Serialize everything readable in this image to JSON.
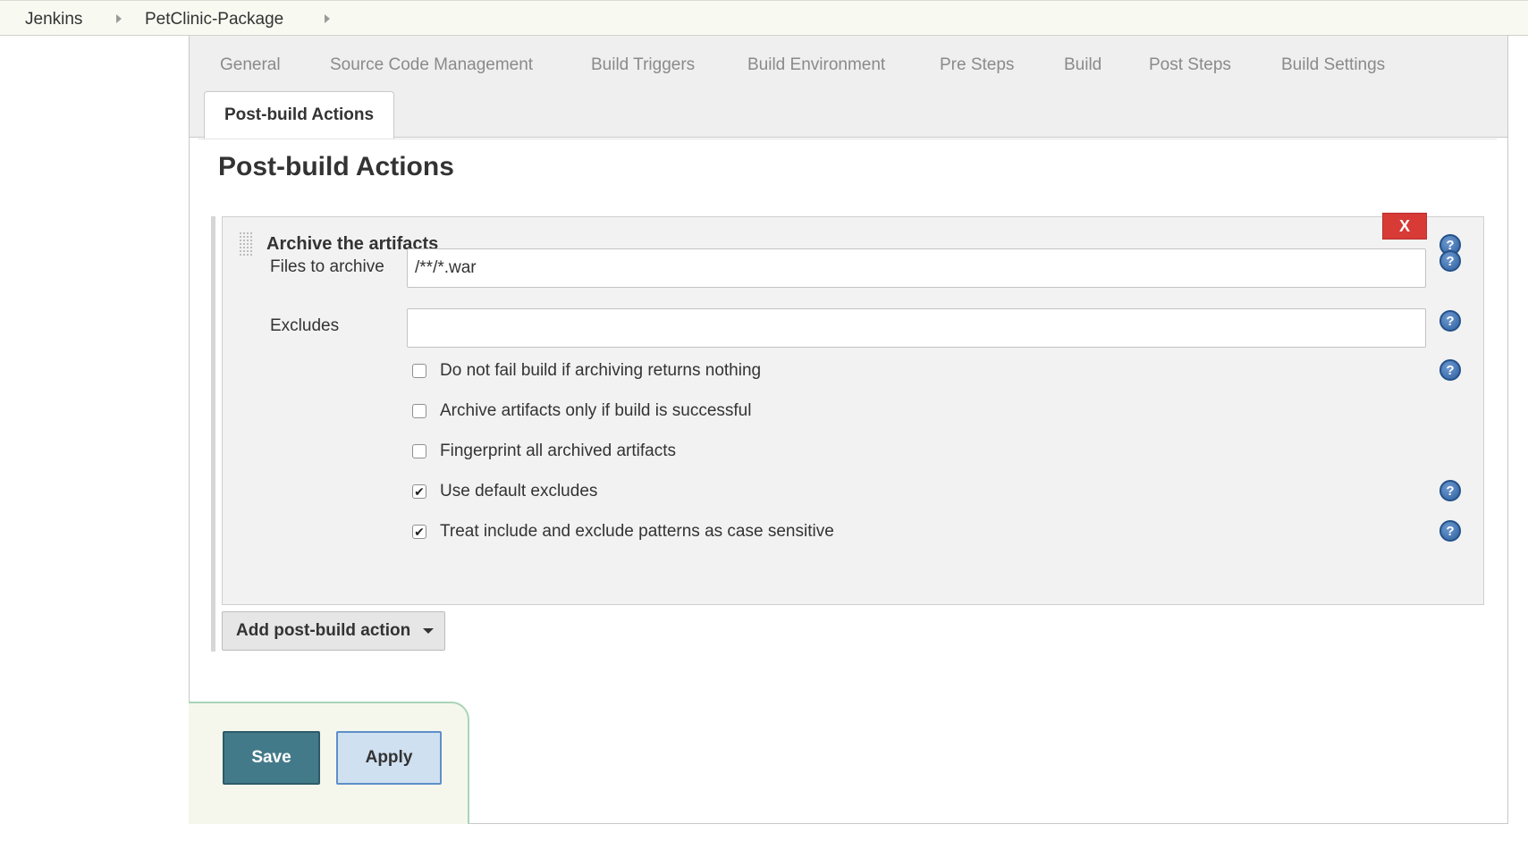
{
  "breadcrumb": {
    "items": [
      "Jenkins",
      "PetClinic-Package"
    ]
  },
  "tabs": {
    "items": [
      "General",
      "Source Code Management",
      "Build Triggers",
      "Build Environment",
      "Pre Steps",
      "Build",
      "Post Steps",
      "Build Settings"
    ],
    "active": "Post-build Actions"
  },
  "section": {
    "title": "Post-build Actions"
  },
  "step": {
    "title": "Archive the artifacts",
    "delete_label": "X",
    "files_label": "Files to archive",
    "files_value": "/**/*.war",
    "excludes_label": "Excludes",
    "excludes_value": "",
    "checkboxes": [
      {
        "label": "Do not fail build if archiving returns nothing",
        "checked": false
      },
      {
        "label": "Archive artifacts only if build is successful",
        "checked": false
      },
      {
        "label": "Fingerprint all archived artifacts",
        "checked": false
      },
      {
        "label": "Use default excludes",
        "checked": true
      },
      {
        "label": "Treat include and exclude patterns as case sensitive",
        "checked": true
      }
    ]
  },
  "add_action": {
    "label": "Add post-build action"
  },
  "buttons": {
    "save": "Save",
    "apply": "Apply"
  },
  "help_symbol": "?",
  "check_symbol": "✔",
  "icons": {
    "breadcrumb_separator": "chevron-right-icon",
    "help": "help-icon",
    "drag": "drag-handle-icon",
    "dropdown": "caret-down-icon"
  },
  "colors": {
    "delete": "#d83a35",
    "save": "#437a8a",
    "apply": "#cfe0f0",
    "help": "#2e5f9e"
  }
}
